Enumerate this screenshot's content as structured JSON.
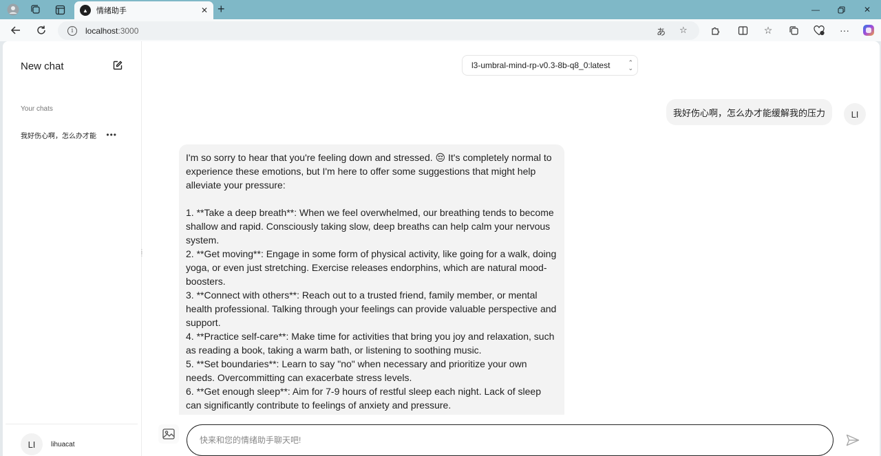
{
  "browser": {
    "tab_title": "情绪助手",
    "url_host": "localhost",
    "url_port": ":3000"
  },
  "sidebar": {
    "new_chat": "New chat",
    "section_title": "Your chats",
    "chats": [
      {
        "label": "我好伤心啊，怎么办才能"
      }
    ],
    "user": {
      "initials": "LI",
      "name": "lihuacat"
    }
  },
  "main": {
    "model": "l3-umbral-mind-rp-v0.3-8b-q8_0:latest",
    "messages": {
      "user": "我好伤心啊，怎么办才能缓解我的压力",
      "user_initials": "LI",
      "assistant": "I'm so sorry to hear that you're feeling down and stressed. 😔 It's completely normal to experience these emotions, but I'm here to offer some suggestions that might help alleviate your pressure:\n\n1. **Take a deep breath**: When we feel overwhelmed, our breathing tends to become shallow and rapid. Consciously taking slow, deep breaths can help calm your nervous system.\n2. **Get moving**: Engage in some form of physical activity, like going for a walk, doing yoga, or even just stretching. Exercise releases endorphins, which are natural mood-boosters.\n3. **Connect with others**: Reach out to a trusted friend, family member, or mental health professional. Talking through your feelings can provide valuable perspective and support.\n4. **Practice self-care**: Make time for activities that bring you joy and relaxation, such as reading a book, taking a warm bath, or listening to soothing music.\n5. **Set boundaries**: Learn to say \"no\" when necessary and prioritize your own needs. Overcommitting can exacerbate stress levels.\n6. **Get enough sleep**: Aim for 7-9 hours of restful sleep each night. Lack of sleep can significantly contribute to feelings of anxiety and pressure."
    },
    "input": {
      "placeholder": "快来和您的情绪助手聊天吧!"
    }
  },
  "icons": [
    "profile-icon",
    "workspaces-icon",
    "tab-actions-icon",
    "close-icon",
    "new-tab-icon",
    "minimize-icon",
    "restore-icon",
    "back-icon",
    "refresh-icon",
    "info-icon",
    "read-aloud-icon",
    "favorite-icon",
    "extensions-icon",
    "split-screen-icon",
    "favorites-icon",
    "collections-icon",
    "browser-essentials-icon",
    "more-icon",
    "copilot-icon",
    "compose-icon",
    "image-icon",
    "send-icon",
    "chevron-updown-icon"
  ]
}
